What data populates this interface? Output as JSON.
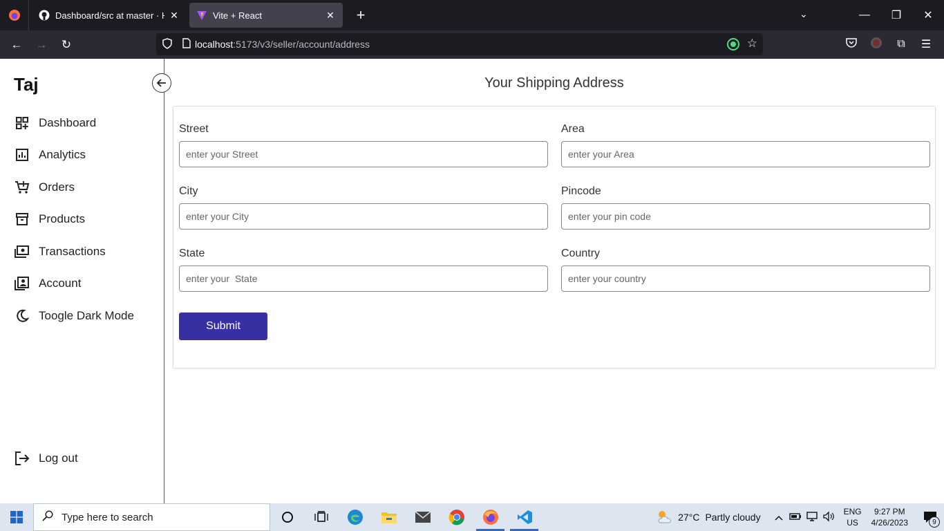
{
  "browser": {
    "tabs": [
      {
        "title": "Dashboard/src at master · Hayat",
        "active": false
      },
      {
        "title": "Vite + React",
        "active": true
      }
    ],
    "url_host": "localhost",
    "url_path": ":5173/v3/seller/account/address"
  },
  "sidebar": {
    "brand": "Taj",
    "items": [
      {
        "label": "Dashboard",
        "icon": "dashboard-icon"
      },
      {
        "label": "Analytics",
        "icon": "analytics-icon"
      },
      {
        "label": "Orders",
        "icon": "cart-icon"
      },
      {
        "label": "Products",
        "icon": "archive-icon"
      },
      {
        "label": "Transactions",
        "icon": "money-icon"
      },
      {
        "label": "Account",
        "icon": "account-box-icon"
      },
      {
        "label": "Toogle Dark Mode",
        "icon": "moon-icon"
      }
    ],
    "logout": "Log out"
  },
  "main": {
    "title": "Your Shipping Address",
    "fields": {
      "street": {
        "label": "Street",
        "placeholder": "enter your Street",
        "value": ""
      },
      "area": {
        "label": "Area",
        "placeholder": "enter your Area",
        "value": ""
      },
      "city": {
        "label": "City",
        "placeholder": "enter your City",
        "value": ""
      },
      "pincode": {
        "label": "Pincode",
        "placeholder": "enter your pin code",
        "value": ""
      },
      "state": {
        "label": "State",
        "placeholder": "enter your  State",
        "value": ""
      },
      "country": {
        "label": "Country",
        "placeholder": "enter your country",
        "value": ""
      }
    },
    "submit_label": "Submit",
    "accent_color": "#3730a3"
  },
  "taskbar": {
    "search_placeholder": "Type here to search",
    "weather_temp": "27°C",
    "weather_text": "Partly cloudy",
    "lang_top": "ENG",
    "lang_bottom": "US",
    "time": "9:27 PM",
    "date": "4/26/2023",
    "notification_count": "9"
  }
}
